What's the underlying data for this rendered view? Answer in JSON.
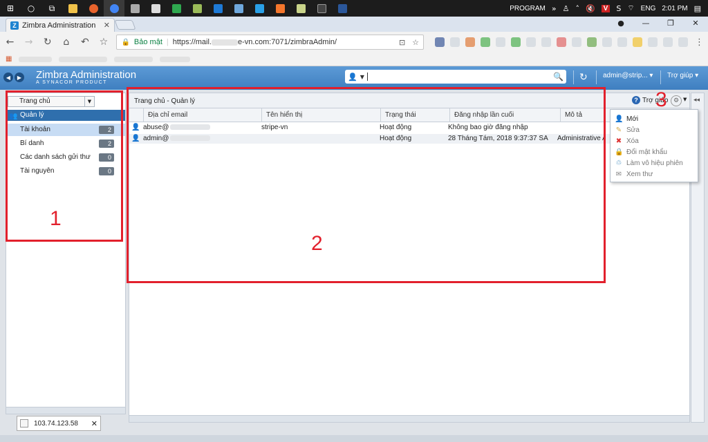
{
  "taskbar": {
    "program_label": "PROGRAM",
    "language": "ENG",
    "time": "2:01 PM"
  },
  "browser": {
    "tab_title": "Zimbra Administration",
    "secure_label": "Bảo mật",
    "url_prefix": "https://mail.",
    "url_suffix": "e-vn.com:7071/zimbraAdmin/"
  },
  "zimbra": {
    "brand_title": "Zimbra Administration",
    "brand_subtitle": "A SYNACOR PRODUCT",
    "user_menu": "admin@strip...",
    "help_menu": "Trợ giúp"
  },
  "sidebar": {
    "dropdown_value": "Trang chủ",
    "section_title": "Quản lý",
    "items": [
      {
        "label": "Tài khoản",
        "count": "2"
      },
      {
        "label": "Bí danh",
        "count": "2"
      },
      {
        "label": "Các danh sách gửi thư",
        "count": "0"
      },
      {
        "label": "Tài nguyên",
        "count": "0"
      }
    ]
  },
  "main": {
    "breadcrumb": "Trang chủ - Quản lý",
    "help_label": "Trợ giúp",
    "columns": [
      "Địa chỉ email",
      "Tên hiển thị",
      "Trạng thái",
      "Đăng nhập lần cuối",
      "Mô tả"
    ],
    "rows": [
      {
        "email": "abuse@",
        "display_name": "stripe-vn",
        "status": "Hoạt động",
        "last_login": "Không bao giờ đăng nhập",
        "description": ""
      },
      {
        "email": "admin@",
        "display_name": "",
        "status": "Hoạt động",
        "last_login": "28 Tháng Tám, 2018 9:37:37 SA",
        "description": "Administrative Ac"
      }
    ]
  },
  "popup_menu": {
    "items": [
      {
        "label": "Mới",
        "icon": "new-account-icon"
      },
      {
        "label": "Sửa",
        "icon": "edit-pencil-icon"
      },
      {
        "label": "Xóa",
        "icon": "delete-x-icon"
      },
      {
        "label": "Đổi mật khẩu",
        "icon": "change-password-icon"
      },
      {
        "label": "Làm vô hiệu phiên",
        "icon": "invalidate-session-icon"
      },
      {
        "label": "Xem thư",
        "icon": "view-mail-icon"
      }
    ]
  },
  "annotations": {
    "box1": "1",
    "box2": "2",
    "box3": "3"
  },
  "status_popup": {
    "ip": "103.74.123.58"
  },
  "colors": {
    "annotation_red": "#e2202c",
    "zimbra_blue": "#3f7fc0",
    "selected_row": "#c7dcf4"
  }
}
